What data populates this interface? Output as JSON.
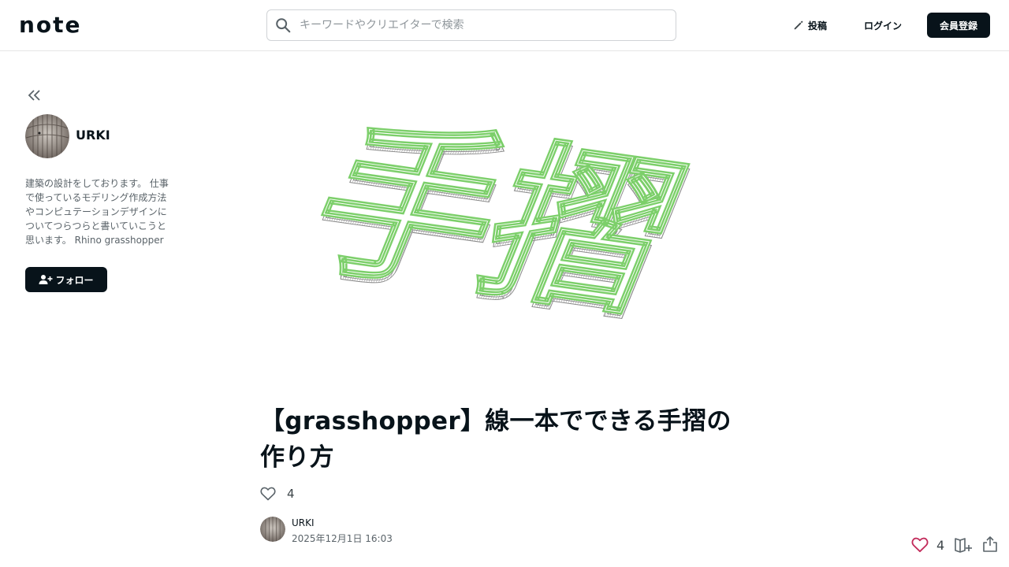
{
  "header": {
    "logo_text": "note",
    "search_placeholder": "キーワードやクリエイターで検索",
    "post_label": "投稿",
    "login_label": "ログイン",
    "signup_label": "会員登録"
  },
  "sidebar": {
    "author_name": "URKI",
    "bio": "建築の設計をしております。 仕事\nで使っているモデリング作成方法\nやコンピュテーションデザインに\nついてつらつらと書いていこうと\n思います。 Rhino grasshopper",
    "follow_label": "フォロー"
  },
  "hero": {
    "text": "手摺"
  },
  "article": {
    "title": "【grasshopper】線一本でできる手摺の作り方",
    "like_count": "4",
    "author_name": "URKI",
    "published": "2025年12月1日 16:03"
  },
  "floating_actions": {
    "like_count": "4"
  },
  "colors": {
    "primary_dark": "#08131a",
    "heart_accent": "#c22a5a",
    "hero_outline": "#7ccf6a"
  },
  "icons": [
    "search-icon",
    "pencil-icon",
    "double-chevron-left-icon",
    "user-plus-icon",
    "heart-icon",
    "magazine-add-icon",
    "share-icon"
  ]
}
